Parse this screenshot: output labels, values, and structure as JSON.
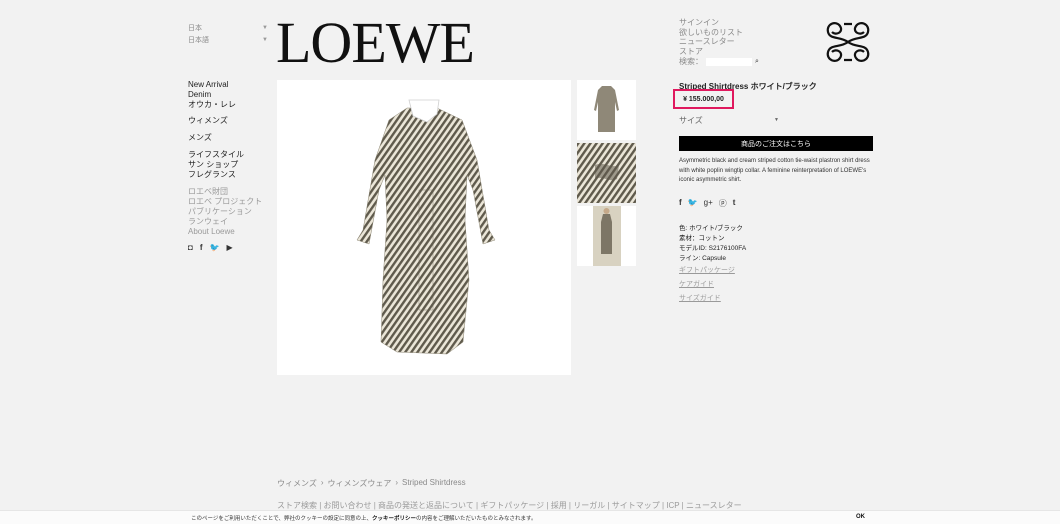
{
  "selectors": {
    "country": "日本",
    "language": "日本語"
  },
  "logo": "LOEWE",
  "topnav": {
    "signin": "サインイン",
    "wishlist": "欲しいものリスト",
    "newsletter": "ニュースレター",
    "store": "ストア",
    "search_label": "検索："
  },
  "leftnav": {
    "group1": [
      "New Arrival",
      "Denim",
      "オウカ・レレ"
    ],
    "group2": [
      "ウィメンズ"
    ],
    "group3": [
      "メンズ"
    ],
    "group4": [
      "ライフスタイル",
      "サン ショップ",
      "フレグランス"
    ],
    "group5": [
      "ロエベ財団",
      "ロエベ プロジェクト",
      "パブリケーション",
      "ランウェイ",
      "About Loewe"
    ]
  },
  "social_icons": [
    "instagram-icon",
    "facebook-icon",
    "twitter-icon",
    "youtube-icon"
  ],
  "product": {
    "name": "Striped Shirtdress ホワイト/ブラック",
    "price": "¥ 155.000,00",
    "size_label": "サイズ",
    "order_button": "商品のご注文はこちら",
    "description": "Asymmetric black and cream striped cotton tie-waist plastron shirt dress with white poplin wingtip collar. A feminine reinterpretation of LOEWE's iconic asymmetric shirt.",
    "share_icons": [
      "facebook-icon",
      "twitter-icon",
      "google-plus-icon",
      "pinterest-icon",
      "tumblr-icon"
    ],
    "color": "色: ホワイト/ブラック",
    "material": "素材：コットン",
    "model_id": "モデルID: S2176100FA",
    "line": "ライン: Capsule",
    "links": [
      "ギフトパッケージ",
      "ケアガイド",
      "サイズガイド"
    ]
  },
  "breadcrumb": [
    "ウィメンズ",
    "ウィメンズウェア",
    "Striped Shirtdress"
  ],
  "footer_links": "ストア検索 | お問い合わせ | 商品の発送と返品について | ギフトパッケージ | 採用 | リーガル | サイトマップ | ICP | ニュースレター",
  "cookie": {
    "text_before": "このページをご利用いただくことで、弊社のクッキーの設定に同意の上、",
    "policy": "クッキーポリシー",
    "text_after": "の内容をご理解いただいたものとみなされます。",
    "ok": "OK"
  },
  "colors": {
    "accent": "#e0195e",
    "background": "#f2f2f2"
  }
}
